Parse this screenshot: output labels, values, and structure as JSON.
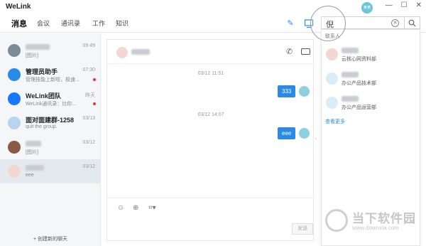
{
  "app": {
    "title": "WeLink"
  },
  "window": {
    "min": "—",
    "max": "☐",
    "close": "✕"
  },
  "nav": {
    "tabs": [
      "消息",
      "会议",
      "通讯录",
      "工作",
      "知识"
    ]
  },
  "user_avatar_text": "某某",
  "search": {
    "value": "倪"
  },
  "conversations": [
    {
      "name": "",
      "preview": "[图片]",
      "time": "09:49",
      "unread": false
    },
    {
      "name": "管理员助手",
      "preview": "管理技能上新啦，极速...",
      "time": "07:30",
      "unread": true
    },
    {
      "name": "WeLink团队",
      "preview": "WeLink通讯录：比你...",
      "time": "昨天",
      "unread": true
    },
    {
      "name": "面对面建群-1258",
      "preview": "quit the group.",
      "time": "03/13",
      "unread": false
    },
    {
      "name": "",
      "preview": "[图片]",
      "time": "03/12",
      "unread": false
    },
    {
      "name": "",
      "preview": "eee",
      "time": "03/12",
      "unread": false
    }
  ],
  "sidebar": {
    "create_chat": "+ 创建新的聊天"
  },
  "chat": {
    "messages": [
      {
        "timestamp": "03/12 11:51",
        "text": "333"
      },
      {
        "timestamp": "03/12 14:07",
        "text": "eee"
      }
    ],
    "send_label": "发送"
  },
  "search_results": {
    "section_label": "联系人",
    "contacts": [
      {
        "dept": "云核心网资料部"
      },
      {
        "dept": "办公产品技术部"
      },
      {
        "dept": "办公产品运营部"
      }
    ],
    "see_more": "查看更多"
  },
  "watermark": {
    "text": "当下软件园",
    "url": "www.downxia.com"
  },
  "colors": {
    "accent": "#2a8ae8",
    "unread": "#e33333"
  }
}
